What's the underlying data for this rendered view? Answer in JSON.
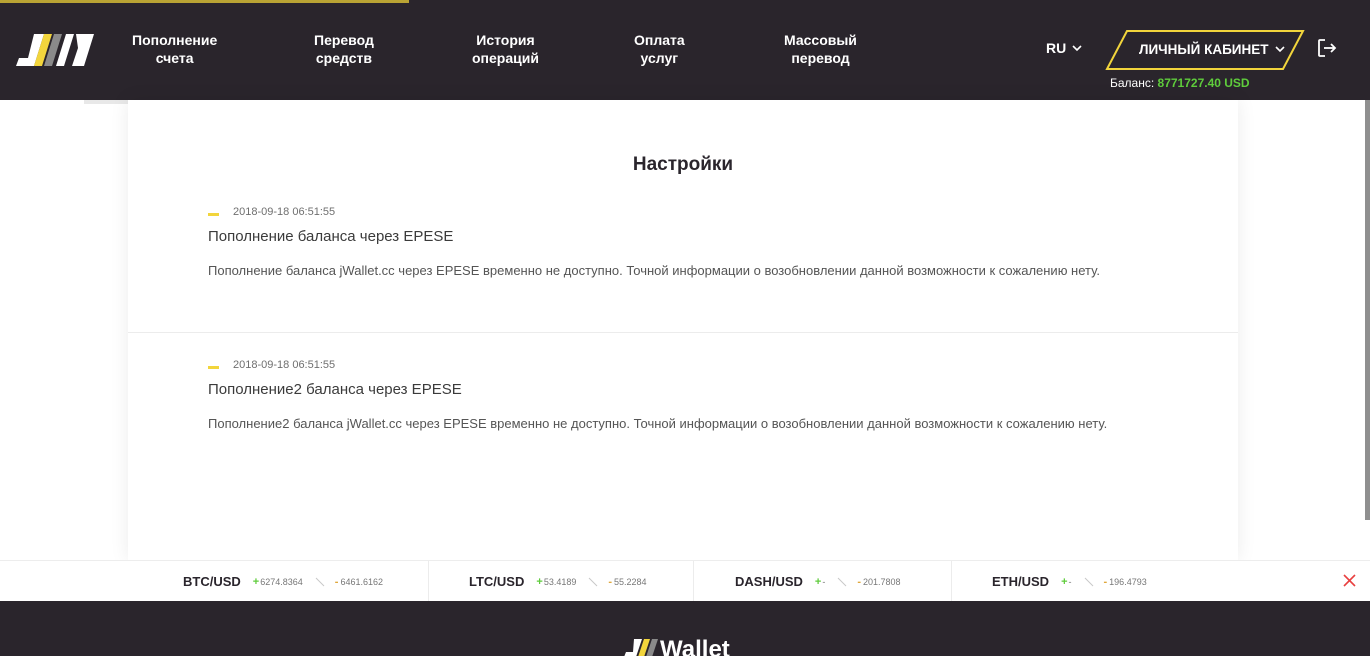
{
  "nav": {
    "items": [
      {
        "line1": "Пополнение",
        "line2": "счета"
      },
      {
        "line1": "Перевод",
        "line2": "средств"
      },
      {
        "line1": "История",
        "line2": "операций"
      },
      {
        "line1": "Оплата",
        "line2": "услуг"
      },
      {
        "line1": "Массовый",
        "line2": "перевод"
      }
    ],
    "lang": "RU",
    "cabinet_label": "ЛИЧНЫЙ КАБИНЕТ",
    "balance_label": "Баланс:",
    "balance_value": "8771727.40 USD"
  },
  "page": {
    "title": "Настройки",
    "news": [
      {
        "date": "2018-09-18 06:51:55",
        "title": "Пополнение баланса через EPESE",
        "body": "Пополнение баланса jWallet.cc через EPESE временно не доступно. Точной информации о возобновлении данной возможности к сожалению нету."
      },
      {
        "date": "2018-09-18 06:51:55",
        "title": "Пополнение2 баланса через EPESE",
        "body": "Пополнение2 баланса jWallet.cc через EPESE временно не доступно. Точной информации о возобновлении данной возможности к сожалению нету."
      }
    ]
  },
  "ticker": [
    {
      "pair": "BTC/USD",
      "buy": "6274.8364",
      "sell": "6461.6162"
    },
    {
      "pair": "LTC/USD",
      "buy": "53.4189",
      "sell": "55.2284"
    },
    {
      "pair": "DASH/USD",
      "buy": "-",
      "sell": "201.7808"
    },
    {
      "pair": "ETH/USD",
      "buy": "-",
      "sell": "196.4793"
    }
  ],
  "footer": {
    "logo_text": "JWallet"
  },
  "colors": {
    "header_bg": "#2a252c",
    "accent_yellow": "#f2d53c",
    "balance_green": "#5fcc3c",
    "close_red": "#e84040"
  }
}
